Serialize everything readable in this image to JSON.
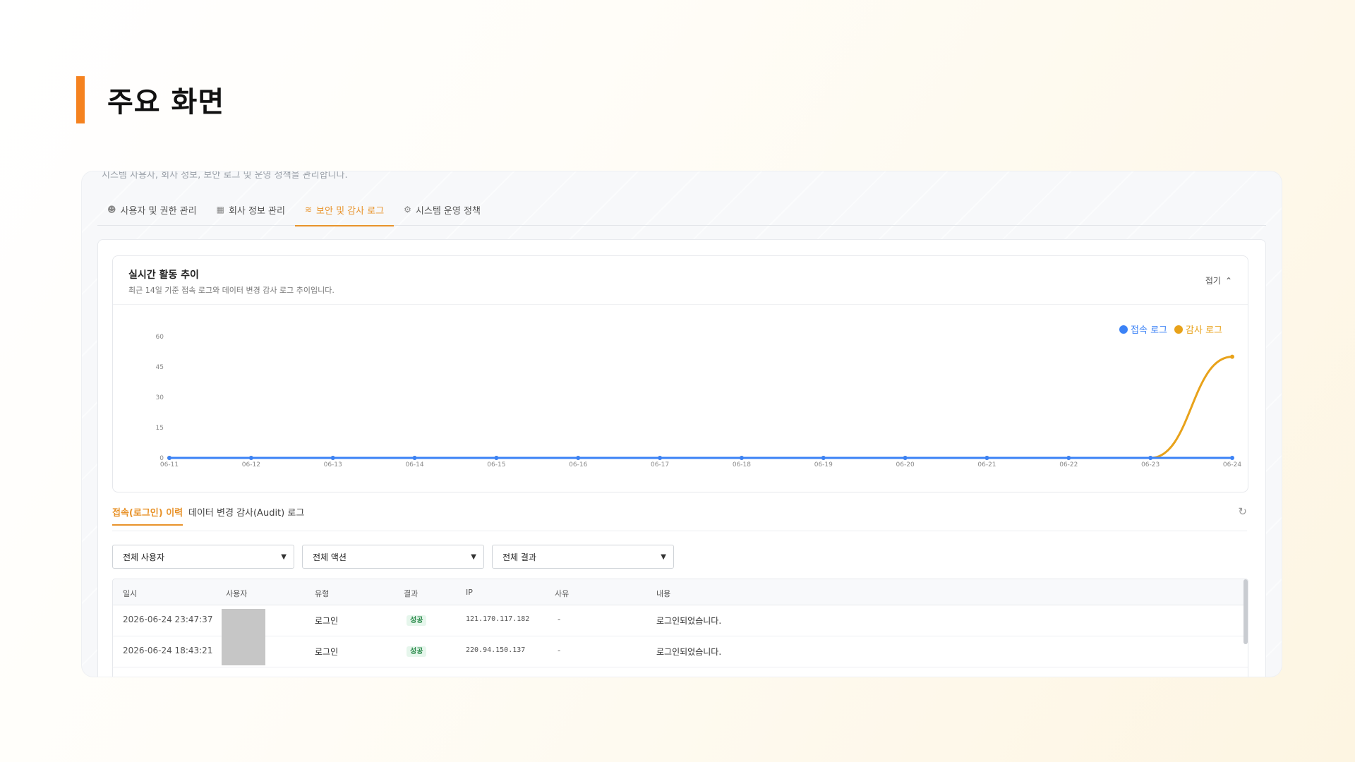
{
  "page": {
    "title": "주요 화면",
    "accent_color": "#f5821f"
  },
  "panel": {
    "cut_text": "시스템 사용자, 회사 정보, 보안 로그 및 운영 정책을 관리합니다.",
    "tabs": [
      {
        "label": "사용자 및 권한 관리",
        "icon": "users-icon",
        "active": false
      },
      {
        "label": "회사 정보 관리",
        "icon": "building-icon",
        "active": false
      },
      {
        "label": "보안 및 감사 로그",
        "icon": "activity-icon",
        "active": true
      },
      {
        "label": "시스템 운영 정책",
        "icon": "gear-icon",
        "active": false
      }
    ]
  },
  "chart_card": {
    "title": "실시간 활동 추이",
    "subtitle": "최근 14일 기준 접속 로그와 데이터 변경 감사 로그 추이입니다.",
    "collapse_label": "접기"
  },
  "chart_data": {
    "type": "line",
    "x": [
      "06-11",
      "06-12",
      "06-13",
      "06-14",
      "06-15",
      "06-16",
      "06-17",
      "06-18",
      "06-19",
      "06-20",
      "06-21",
      "06-22",
      "06-23",
      "06-24"
    ],
    "yticks": [
      0,
      15,
      30,
      45,
      60
    ],
    "ylim": [
      0,
      60
    ],
    "series": [
      {
        "name": "접속 로그",
        "color": "#3b82f6",
        "values": [
          0,
          0,
          0,
          0,
          0,
          0,
          0,
          0,
          0,
          0,
          0,
          0,
          0,
          0
        ]
      },
      {
        "name": "감사 로그",
        "color": "#e8a21a",
        "values": [
          0,
          0,
          0,
          0,
          0,
          0,
          0,
          0,
          0,
          0,
          0,
          0,
          0,
          50
        ]
      }
    ],
    "legend_position": "top-right",
    "grid": false
  },
  "logs": {
    "subtabs": [
      {
        "label": "접속(로그인) 이력",
        "active": true
      },
      {
        "label": "데이터 변경 감사(Audit) 로그",
        "active": false
      }
    ],
    "filters": [
      {
        "value": "전체 사용자"
      },
      {
        "value": "전체 액션"
      },
      {
        "value": "전체 결과"
      }
    ],
    "columns": [
      "일시",
      "사용자",
      "유형",
      "결과",
      "IP",
      "사유",
      "내용"
    ],
    "rows": [
      {
        "datetime": "2026-06-24 23:47:37",
        "type": "로그인",
        "result": "성공",
        "ip": "121.170.117.182",
        "reason": "-",
        "content": "로그인되었습니다."
      },
      {
        "datetime": "2026-06-24 18:43:21",
        "type": "로그인",
        "result": "성공",
        "ip": "220.94.150.137",
        "reason": "-",
        "content": "로그인되었습니다."
      }
    ]
  }
}
